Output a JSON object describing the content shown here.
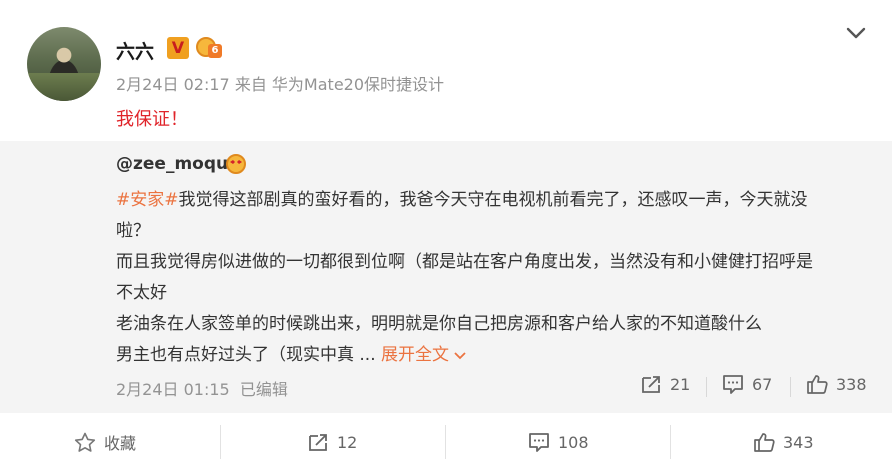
{
  "post": {
    "username": "六六",
    "verified_badge": "V",
    "level_badge": "6",
    "time": "2月24日 02:17",
    "source": "来自 华为Mate20保时捷设计",
    "text": "我保证！"
  },
  "quote": {
    "username": "@zee_moqu",
    "hashtag": "#安家#",
    "line1": "我觉得这部剧真的蛮好看的，我爸今天守在电视机前看完了，还感叹一声，今天就没",
    "line2": "啦？",
    "line3": "而且我觉得房似进做的一切都很到位啊（都是站在客户角度出发，当然没有和小健健打招呼是",
    "line4": "不太好",
    "line5": "老油条在人家签单的时候跳出来，明明就是你自己把房源和客户给人家的不知道酸什么",
    "line6": "男主也有点好过头了（现实中真 ...",
    "expand_label": "展开全文",
    "time": "2月24日 01:15",
    "edited": "已编辑",
    "reposts": "21",
    "comments": "67",
    "likes": "338"
  },
  "actions": {
    "favorite_label": "收藏",
    "reposts": "12",
    "comments": "108",
    "likes": "343"
  },
  "colors": {
    "accent_red": "#e0242a",
    "hashtag_orange": "#eb7340",
    "quote_bg": "#f4f4f4"
  }
}
